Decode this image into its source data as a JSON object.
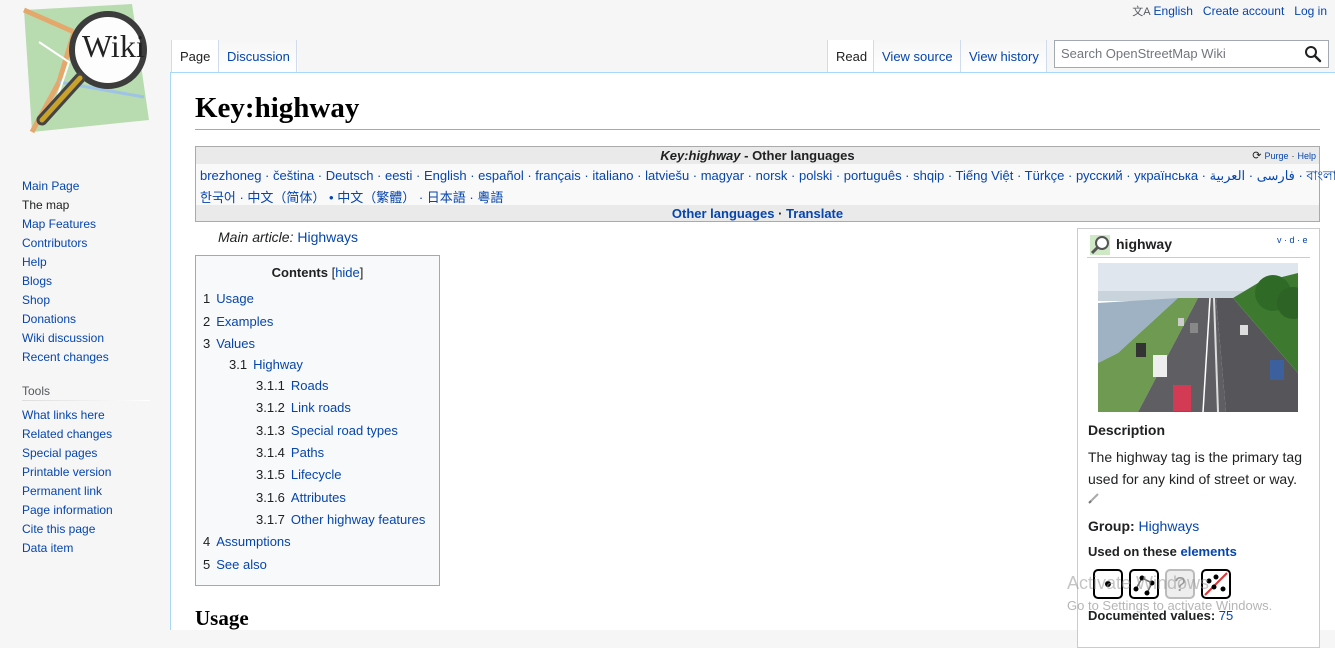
{
  "personal": {
    "language": "English",
    "create_account": "Create account",
    "login": "Log in"
  },
  "tabs": {
    "page": "Page",
    "discussion": "Discussion",
    "read": "Read",
    "view_source": "View source",
    "view_history": "View history"
  },
  "search": {
    "placeholder": "Search OpenStreetMap Wiki"
  },
  "logo": {
    "text": "Wiki"
  },
  "sidebar": {
    "nav": [
      "Main Page",
      "The map",
      "Map Features",
      "Contributors",
      "Help",
      "Blogs",
      "Shop",
      "Donations",
      "Wiki discussion",
      "Recent changes"
    ],
    "tools_heading": "Tools",
    "tools": [
      "What links here",
      "Related changes",
      "Special pages",
      "Printable version",
      "Permanent link",
      "Page information",
      "Cite this page",
      "Data item"
    ]
  },
  "page": {
    "title": "Key:highway",
    "main_article_label": "Main article:",
    "main_article_link": "Highways",
    "usage_heading": "Usage"
  },
  "languages": {
    "title_italic": "Key:highway",
    "title_rest": " - Other languages",
    "purge": "Purge",
    "help": "Help",
    "row1": "brezhoneg · čeština · Deutsch · eesti · English · español · français · italiano · latviešu · magyar · norsk · polski · português · shqip · Tiếng Việt · Türkçe · русский · українська · فارسی · العربية · বাংলা ·",
    "row2": "한국어 · 中文（简体） • 中文（繁體） · 日本語 · 粵語",
    "other_languages": "Other languages",
    "translate": "Translate"
  },
  "toc": {
    "title": "Contents",
    "hide": "hide",
    "items": [
      {
        "num": "1",
        "label": "Usage"
      },
      {
        "num": "2",
        "label": "Examples"
      },
      {
        "num": "3",
        "label": "Values"
      },
      {
        "num": "3.1",
        "label": "Highway"
      },
      {
        "num": "3.1.1",
        "label": "Roads"
      },
      {
        "num": "3.1.2",
        "label": "Link roads"
      },
      {
        "num": "3.1.3",
        "label": "Special road types"
      },
      {
        "num": "3.1.4",
        "label": "Paths"
      },
      {
        "num": "3.1.5",
        "label": "Lifecycle"
      },
      {
        "num": "3.1.6",
        "label": "Attributes"
      },
      {
        "num": "3.1.7",
        "label": "Other highway features"
      },
      {
        "num": "4",
        "label": "Assumptions"
      },
      {
        "num": "5",
        "label": "See also"
      }
    ]
  },
  "infobox": {
    "title": "highway",
    "vde": "v · d · e",
    "description_label": "Description",
    "description": "The highway tag is the primary tag used for any kind of street or way.",
    "group_label": "Group:",
    "group_value": "Highways",
    "used_on_label": "Used on these",
    "used_on_link": "elements",
    "documented_label": "Documented values:",
    "documented_value": "75"
  },
  "watermark": {
    "line1": "Activate Windows",
    "line2": "Go to Settings to activate Windows."
  }
}
